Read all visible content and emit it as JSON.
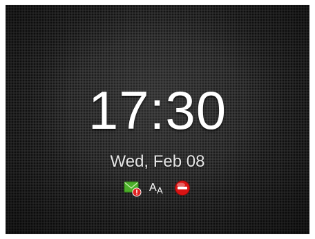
{
  "lockscreen": {
    "time": "17:30",
    "date": "Wed, Feb 08"
  },
  "status_icons": {
    "mail": "envelope-alert-icon",
    "font": "font-size-icon",
    "profile": "do-not-disturb-icon"
  },
  "colors": {
    "envelope": "#4caf2a",
    "alert_badge": "#e02020",
    "dnd": "#d81414",
    "text": "#ffffff"
  }
}
